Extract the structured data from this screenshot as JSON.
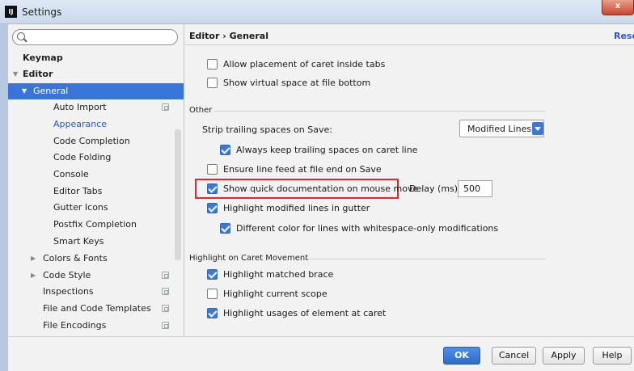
{
  "window": {
    "title": "Settings",
    "close_label": "x",
    "app_icon": "IJ"
  },
  "sidebar": {
    "search_placeholder": "",
    "items": [
      {
        "label": "Keymap"
      },
      {
        "label": "Editor"
      },
      {
        "label": "General"
      },
      {
        "label": "Auto Import"
      },
      {
        "label": "Appearance"
      },
      {
        "label": "Code Completion"
      },
      {
        "label": "Code Folding"
      },
      {
        "label": "Console"
      },
      {
        "label": "Editor Tabs"
      },
      {
        "label": "Gutter Icons"
      },
      {
        "label": "Postfix Completion"
      },
      {
        "label": "Smart Keys"
      },
      {
        "label": "Colors & Fonts"
      },
      {
        "label": "Code Style"
      },
      {
        "label": "Inspections"
      },
      {
        "label": "File and Code Templates"
      },
      {
        "label": "File Encodings"
      }
    ]
  },
  "content": {
    "breadcrumb": "Editor › General",
    "reset_label": "Reset",
    "options_top": [
      {
        "label": "Allow placement of caret inside tabs",
        "checked": false
      },
      {
        "label": "Show virtual space at file bottom",
        "checked": false
      }
    ],
    "other_section": {
      "title": "Other",
      "strip_label": "Strip trailing spaces on Save:",
      "strip_value": "Modified Lines",
      "keep_trailing": "Always keep trailing spaces on caret line",
      "ensure_line_feed": "Ensure line feed at file end on Save",
      "quick_doc": "Show quick documentation on mouse move",
      "delay_label": "Delay (ms):",
      "delay_value": "500",
      "highlight_modified": "Highlight modified lines in gutter",
      "different_color": "Different color for lines with whitespace-only modifications"
    },
    "caret_section": {
      "title": "Highlight on Caret Movement",
      "matched_brace": "Highlight matched brace",
      "current_scope": "Highlight current scope",
      "usages": "Highlight usages of element at caret"
    }
  },
  "footer": {
    "ok": "OK",
    "cancel": "Cancel",
    "apply": "Apply",
    "help": "Help"
  },
  "colors": {
    "selection": "#3875d7",
    "accent": "#3d7ad6",
    "highlight_box": "#e8262a",
    "link": "#2b57c8"
  }
}
